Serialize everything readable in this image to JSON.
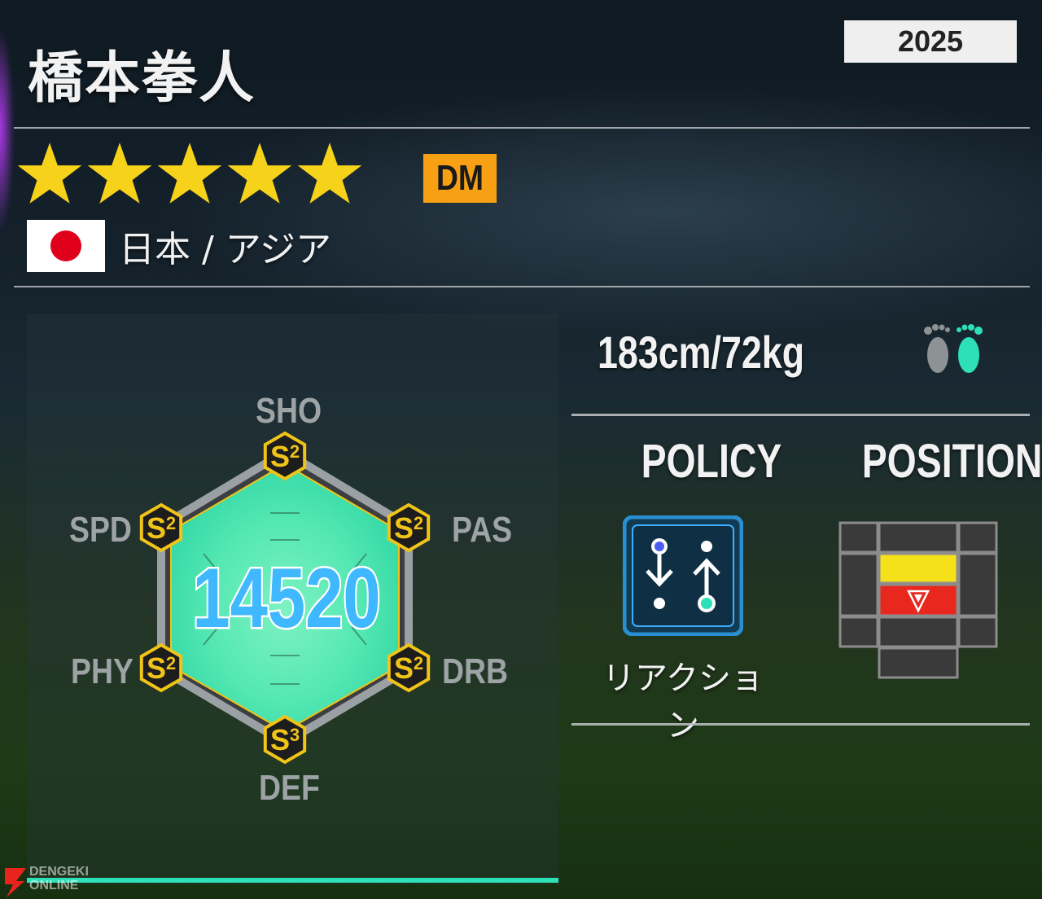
{
  "player": {
    "name": "橋本拳人",
    "year": "2025",
    "stars": 5,
    "position": "DM",
    "nation": "日本 / アジア",
    "flag": "japan-flag"
  },
  "colors": {
    "star": "#f7d21a",
    "position_badge": "#f7a013",
    "accent": "#2ee0b8",
    "rank_badge": "#f0c419",
    "overall_text": "#3fb8ff"
  },
  "radar": {
    "overall": "14520",
    "stats": [
      {
        "label": "SHO",
        "rank": "S",
        "level": "2"
      },
      {
        "label": "PAS",
        "rank": "S",
        "level": "2"
      },
      {
        "label": "DRB",
        "rank": "S",
        "level": "2"
      },
      {
        "label": "DEF",
        "rank": "S",
        "level": "3"
      },
      {
        "label": "PHY",
        "rank": "S",
        "level": "2"
      },
      {
        "label": "SPD",
        "rank": "S",
        "level": "2"
      }
    ]
  },
  "profile": {
    "body": "183cm/72kg",
    "foot_icon": "feet-icon",
    "policy_heading": "POLICY",
    "position_heading": "POSITION",
    "policy_name": "リアクション",
    "policy_icon": "policy-reaction-icon",
    "position_map_icon": "position-map-icon"
  },
  "watermark": {
    "line1": "DENGEKI",
    "line2": "ONLINE"
  }
}
